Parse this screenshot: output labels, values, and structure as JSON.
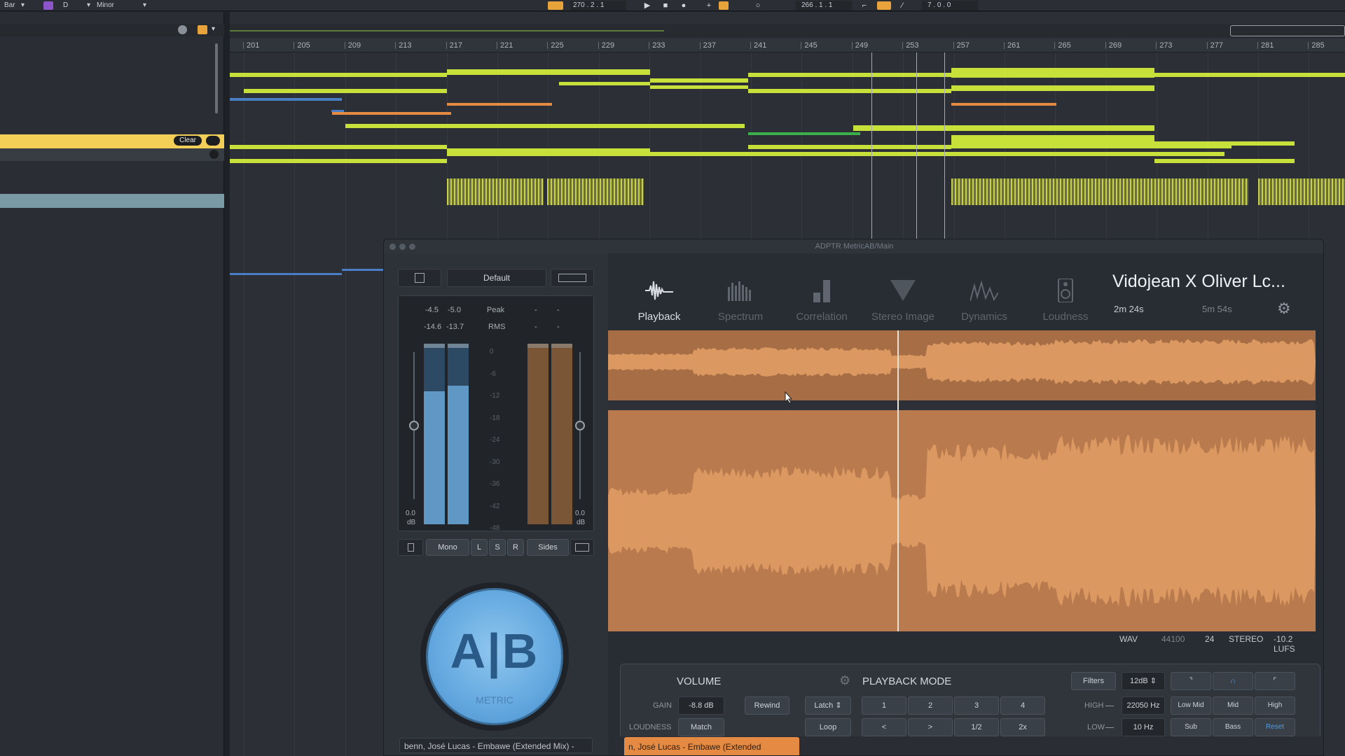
{
  "topbar": {
    "bar_label": "Bar",
    "key_label": "D",
    "scale_label": "Minor",
    "position_display": "270 . 2 . 1",
    "loop_display": "266 . 1 . 1",
    "length_display": "7 . 0 . 0"
  },
  "track_header": {
    "clear_label": "Clear"
  },
  "ruler": {
    "bars": [
      "201",
      "205",
      "209",
      "213",
      "217",
      "221",
      "225",
      "229",
      "233",
      "237",
      "241",
      "245",
      "249",
      "253",
      "257",
      "261",
      "265",
      "269",
      "273",
      "277",
      "281",
      "285"
    ]
  },
  "plugin": {
    "window_title": "ADPTR MetricAB/Main",
    "preset": "Default",
    "meter": {
      "peak_left": "-4.5",
      "peak_right": "-5.0",
      "peak_label": "Peak",
      "rms_left": "-14.6",
      "rms_right": "-13.7",
      "rms_label": "RMS",
      "dash": "-",
      "scale": [
        "0",
        "-6",
        "-12",
        "-18",
        "-24",
        "-30",
        "-36",
        "-42",
        "-48"
      ],
      "left_gain": "0.0",
      "right_gain": "0.0",
      "unit": "dB"
    },
    "monitor_buttons": [
      "Mono",
      "L",
      "S",
      "R",
      "Sides"
    ],
    "ab_letters": "A|B",
    "ab_brand": "METRIC",
    "track_name": "benn, José Lucas - Embawe (Extended Mix) -",
    "tabs": [
      "Playback",
      "Spectrum",
      "Correlation",
      "Stereo Image",
      "Dynamics",
      "Loudness"
    ],
    "song_title": "Vidojean X Oliver Lc...",
    "current_time": "2m 24s",
    "total_time": "5m 54s",
    "file_info": {
      "format": "WAV",
      "sample_rate": "44100",
      "bit_depth": "24",
      "channels": "STEREO",
      "loudness": "-10.2 LUFS"
    },
    "volume": {
      "heading": "VOLUME",
      "gain_label": "GAIN",
      "gain_value": "-8.8 dB",
      "loudness_label": "LOUDNESS",
      "match_label": "Match"
    },
    "playback_mode": {
      "heading": "PLAYBACK MODE",
      "rewind": "Rewind",
      "latch": "Latch",
      "loop": "Loop",
      "cue_buttons": [
        "1",
        "2",
        "3",
        "4"
      ],
      "nav_buttons": [
        "<",
        ">",
        "1/2",
        "2x"
      ]
    },
    "filters": {
      "label": "Filters",
      "slope": "12dB",
      "high_label": "HIGH",
      "high_value": "22050 Hz",
      "low_label": "LOW",
      "low_value": "10 Hz",
      "bands_top": [
        "Low Mid",
        "Mid",
        "High"
      ],
      "bands_bottom": [
        "Sub",
        "Bass",
        "Reset"
      ]
    },
    "bottom_track": "n, José Lucas - Embawe (Extended"
  },
  "colors": {
    "accent_orange": "#e58a42",
    "clip_yellow": "#c8e03a",
    "waveform": "#dd9a62",
    "ab_blue": "#6aaee3"
  }
}
